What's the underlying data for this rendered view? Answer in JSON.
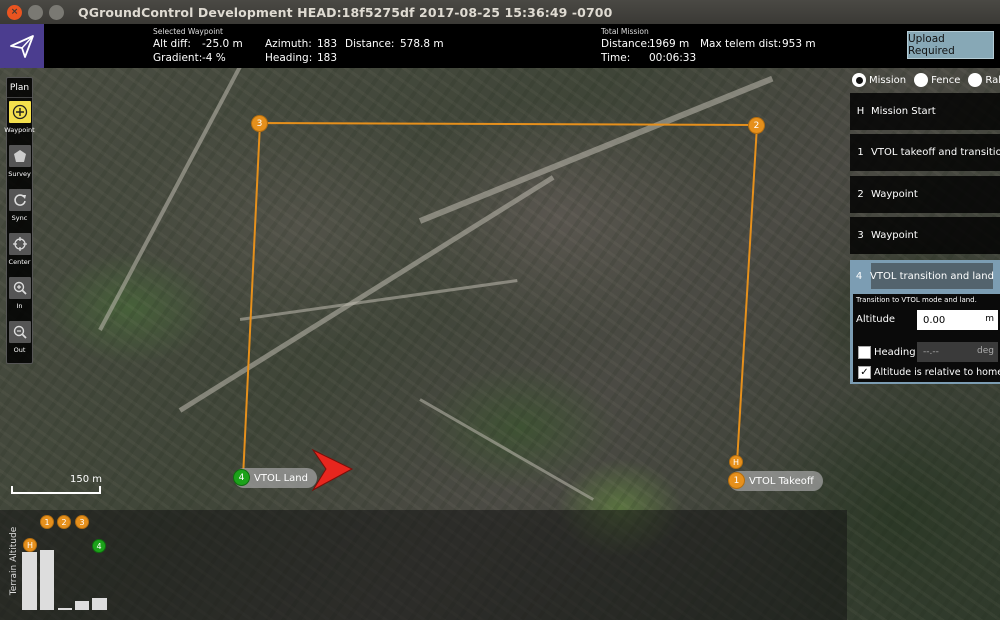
{
  "window": {
    "title": "QGroundControl Development HEAD:18f5275df 2017-08-25 15:36:49 -0700",
    "close_glyph": "×"
  },
  "toolbar": {
    "selected_waypoint": {
      "section_title": "Selected Waypoint",
      "alt_diff_label": "Alt diff:",
      "alt_diff_value": "-25.0 m",
      "gradient_label": "Gradient:",
      "gradient_value": "-4 %",
      "azimuth_label": "Azimuth:",
      "azimuth_value": "183",
      "heading_label": "Heading:",
      "heading_value": "183",
      "distance_label": "Distance:",
      "distance_value": "578.8 m"
    },
    "total_mission": {
      "section_title": "Total Mission",
      "distance_label": "Distance:",
      "distance_value": "1969 m",
      "time_label": "Time:",
      "time_value": "00:06:33",
      "max_telem_label": "Max telem dist:",
      "max_telem_value": "953 m"
    },
    "upload_label": "Upload Required"
  },
  "plan_tools": {
    "title": "Plan",
    "items": [
      {
        "label": "Waypoint",
        "icon": "plus-circle-icon",
        "active": true
      },
      {
        "label": "Survey",
        "icon": "survey-polygon-icon",
        "active": false
      },
      {
        "label": "Sync",
        "icon": "sync-icon",
        "active": false
      },
      {
        "label": "Center",
        "icon": "crosshair-icon",
        "active": false
      },
      {
        "label": "In",
        "icon": "zoom-in-icon",
        "active": false
      },
      {
        "label": "Out",
        "icon": "zoom-out-icon",
        "active": false
      }
    ]
  },
  "layer_selector": {
    "options": [
      "Mission",
      "Fence",
      "Rally"
    ],
    "selected": "Mission"
  },
  "mission_items": [
    {
      "num": "H",
      "label": "Mission Start"
    },
    {
      "num": "1",
      "label": "VTOL takeoff and transition"
    },
    {
      "num": "2",
      "label": "Waypoint"
    },
    {
      "num": "3",
      "label": "Waypoint"
    }
  ],
  "active_item": {
    "num": "4",
    "command": "VTOL transition and land",
    "description": "Transition to VTOL mode and land.",
    "altitude_label": "Altitude",
    "altitude_value": "0.00",
    "altitude_unit": "m",
    "heading_label": "Heading",
    "heading_placeholder": "--.--",
    "heading_unit": "deg",
    "heading_checked": false,
    "relative_label": "Altitude is relative to home",
    "relative_checked": true,
    "check_glyph": "✓"
  },
  "map": {
    "scale_label": "150 m",
    "markers": [
      {
        "num": "3"
      },
      {
        "num": "2"
      },
      {
        "num": "4",
        "tag": "VTOL Land"
      },
      {
        "num": "1",
        "tag": "VTOL Takeoff"
      },
      {
        "num": "H"
      }
    ]
  },
  "terrain": {
    "title": "Terrain Altitude",
    "markers": [
      "1",
      "2",
      "3",
      "H",
      "4"
    ]
  },
  "colors": {
    "accent_orange": "#e6901c",
    "land_green": "#1ca21a",
    "active_item_bg": "#7c9db3",
    "upload_bg": "#87a8b6",
    "logo_purple": "#4b3d8f"
  }
}
